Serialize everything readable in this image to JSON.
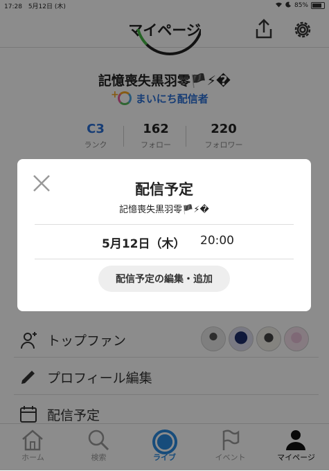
{
  "status_bar": {
    "time": "17:28",
    "date": "5月12日 (木)",
    "battery": "85%",
    "battery_level": 0.85
  },
  "header": {
    "title": "マイページ",
    "share_icon": "share-icon",
    "settings_icon": "gear-icon"
  },
  "profile": {
    "name": "記憶喪失黒羽零🏴⚡�",
    "badge": "まいにち配信者",
    "stats": [
      {
        "value": "C3",
        "label": "ランク"
      },
      {
        "value": "162",
        "label": "フォロー"
      },
      {
        "value": "220",
        "label": "フォロワー"
      }
    ]
  },
  "menu": [
    {
      "label": "トップファン",
      "icon": "person-plus-icon"
    },
    {
      "label": "プロフィール編集",
      "icon": "pencil-icon"
    },
    {
      "label": "配信予定",
      "icon": "calendar-icon"
    }
  ],
  "modal": {
    "title": "配信予定",
    "name": "記憶喪失黒羽零🏴⚡�",
    "date": "5月12日（木）",
    "time": "20:00",
    "button": "配信予定の編集・追加"
  },
  "tabs": [
    {
      "label": "ホーム",
      "icon": "home-icon"
    },
    {
      "label": "検索",
      "icon": "search-icon"
    },
    {
      "label": "ライブ",
      "icon": "live-icon"
    },
    {
      "label": "イベント",
      "icon": "flag-icon"
    },
    {
      "label": "マイページ",
      "icon": "person-icon"
    }
  ],
  "colors": {
    "accent": "#2a8ae0",
    "link": "#2b6fd6",
    "overlay": "rgba(0,0,0,0.45)"
  }
}
